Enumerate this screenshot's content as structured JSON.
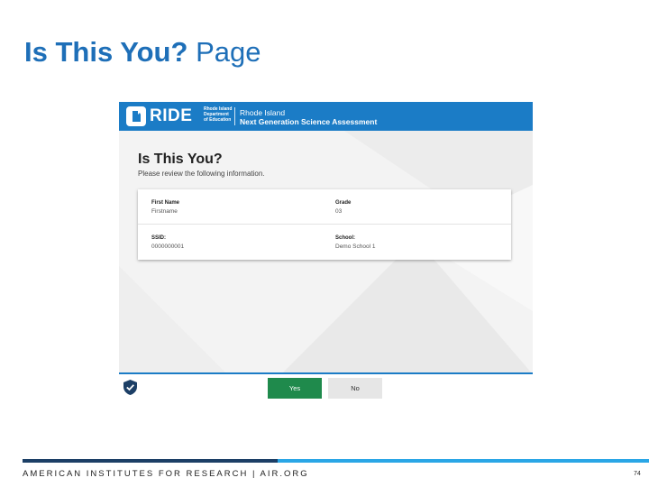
{
  "slide": {
    "title_bold": "Is This You?",
    "title_light": "Page"
  },
  "app": {
    "logo_text": "RIDE",
    "logo_department": "Rhode Island\nDepartment\nof Education",
    "header_line1": "Rhode Island",
    "header_line2": "Next Generation Science Assessment",
    "brand_color": "#1b7cc6"
  },
  "verification": {
    "heading": "Is This You?",
    "subheading": "Please review the following information.",
    "fields": [
      {
        "label": "First Name",
        "value": "Firstname"
      },
      {
        "label": "Grade",
        "value": "03"
      },
      {
        "label": "SSID:",
        "value": "0000000001"
      },
      {
        "label": "School:",
        "value": "Demo School 1"
      }
    ]
  },
  "actions": {
    "yes_label": "Yes",
    "no_label": "No",
    "yes_color": "#1f8a4c"
  },
  "footer": {
    "text": "AMERICAN INSTITUTES FOR RESEARCH | AIR.ORG",
    "page_number": "74"
  }
}
